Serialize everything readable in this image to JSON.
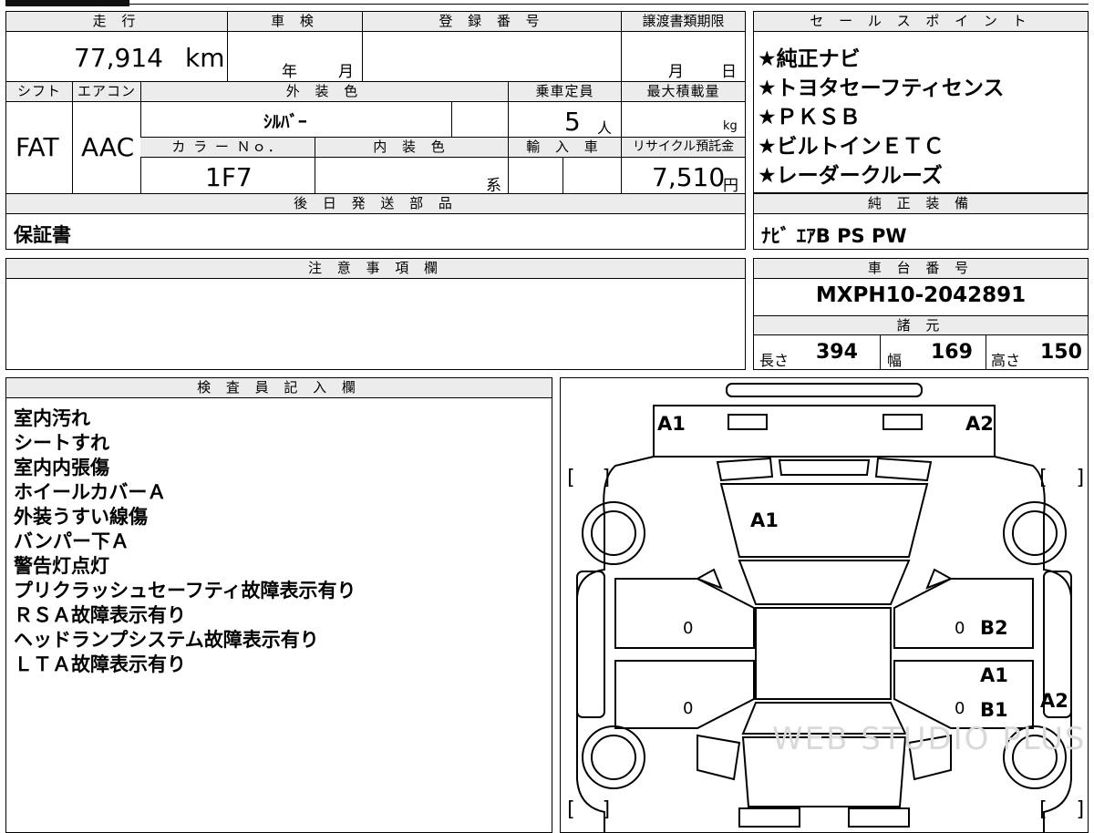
{
  "vehicle": {
    "mileage_header": "走 行",
    "mileage_value": "77,914",
    "mileage_unit": "km",
    "shaken_header": "車 検",
    "shaken_year_label": "年",
    "shaken_month_label": "月",
    "registration_header": "登 録 番 号",
    "transfer_header": "譲渡書類期限",
    "transfer_month_label": "月",
    "transfer_day_label": "日",
    "shift_header": "シフト",
    "shift_value": "FAT",
    "ac_header": "エアコン",
    "ac_value": "AAC",
    "ext_color_header": "外 装 色",
    "ext_color_value": "ｼﾙﾊﾞｰ",
    "capacity_header": "乗車定員",
    "capacity_value": "5",
    "capacity_unit": "人",
    "max_load_header": "最大積載量",
    "max_load_unit": "kg",
    "color_no_header": "カ ラ ー Ｎｏ．",
    "color_no_value": "1F7",
    "int_color_header": "内 装 色",
    "int_color_suffix": "系",
    "import_header": "輸 入 車",
    "recycle_header": "リサイクル預託金",
    "recycle_value": "7,510",
    "recycle_unit": "円"
  },
  "later_parts": {
    "header": "後 日 発 送 部 品",
    "value": "保証書"
  },
  "sales_points": {
    "header": "セ ー ル ス ポ イ ン ト",
    "items": [
      "★純正ナビ",
      "★トヨタセーフティセンス",
      "★ＰＫＳＢ",
      "★ビルトインＥＴＣ",
      "★レーダークルーズ"
    ]
  },
  "equipment": {
    "header": "純 正 装 備",
    "value": "ﾅﾋﾞ ｴｱB PS PW"
  },
  "notes": {
    "header": "注 意 事 項 欄"
  },
  "chassis": {
    "header": "車 台 番 号",
    "value": "MXPH10-2042891"
  },
  "specs": {
    "header": "諸 元",
    "length_label": "長さ",
    "length_value": "394",
    "width_label": "幅",
    "width_value": "169",
    "height_label": "高さ",
    "height_value": "150"
  },
  "inspector": {
    "header": "検 査 員 記 入 欄",
    "remarks": [
      "室内汚れ",
      "シートすれ",
      "室内内張傷",
      "ホイールカバーＡ",
      "外装うすい線傷",
      "バンパー下Ａ",
      "警告灯点灯",
      "プリクラッシュセーフティ故障表示有り",
      "ＲＳＡ故障表示有り",
      "ヘッドランプシステム故障表示有り",
      "ＬＴＡ故障表示有り"
    ]
  },
  "diagram": {
    "marks": {
      "front_left_corner": "A1",
      "front_right_corner": "A2",
      "hood": "A1",
      "right_front_door": "B2",
      "right_rear_door_top": "A1",
      "right_rear_door": "B1",
      "right_rear_quarter": "A2",
      "left_front_door_zero": "0",
      "left_rear_door_zero": "0",
      "right_front_door_zero": "0",
      "right_rear_door_zero": "0"
    },
    "watermark": "WEB STUDIO PLUS"
  }
}
